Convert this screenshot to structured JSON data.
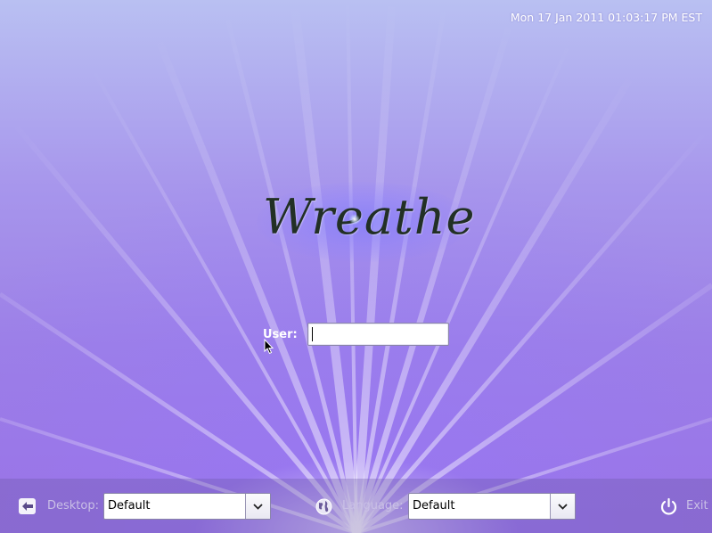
{
  "header": {
    "clock": "Mon 17 Jan 2011 01:03:17 PM EST"
  },
  "branding": {
    "logo_text": "Wreathe"
  },
  "login": {
    "user_label": "User:",
    "user_value": ""
  },
  "bottom_bar": {
    "desktop_label": "Desktop:",
    "desktop_value": "Default",
    "language_label": "Language:",
    "language_value": "Default",
    "exit_label": "Exit"
  },
  "icons": {
    "back": "back-arrow-icon",
    "language": "globe-icon",
    "exit": "power-icon",
    "dropdown": "chevron-down-icon",
    "pointer": "mouse-pointer-icon"
  },
  "colors": {
    "bg_top": "#b9c0f2",
    "bg_bottom": "#9a72e2",
    "bar_text": "#c9bfe6",
    "logo": "#223025"
  }
}
